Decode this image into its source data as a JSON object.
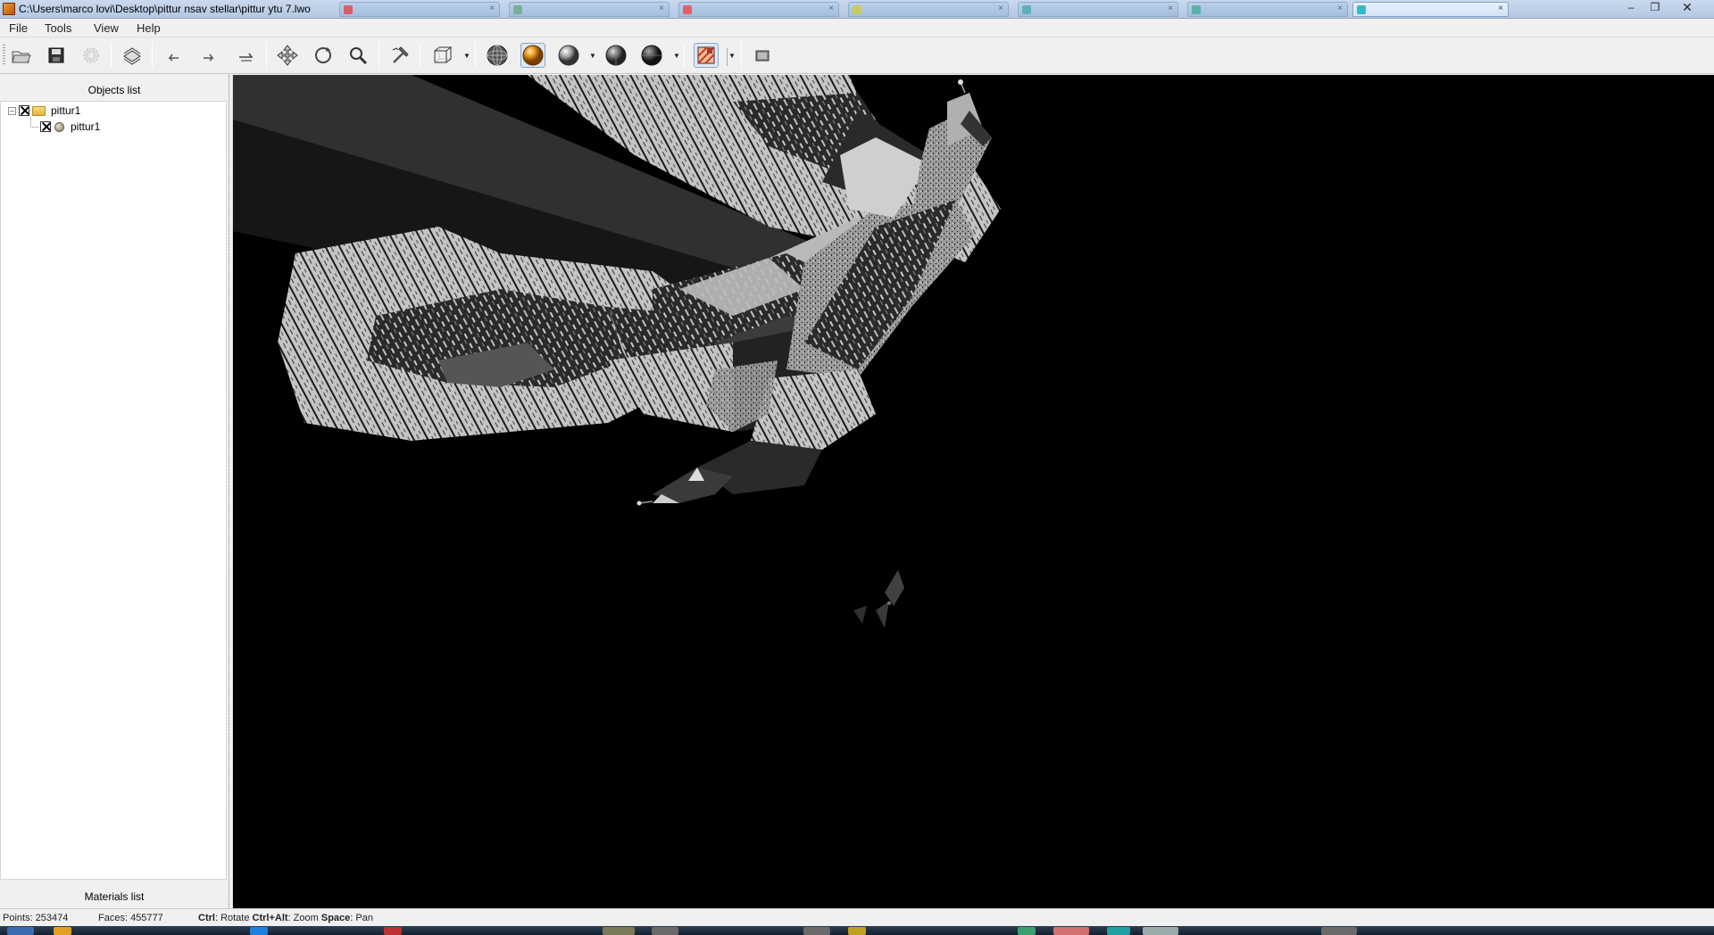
{
  "window": {
    "title": "C:\\Users\\marco lovi\\Desktop\\pittur nsav stellar\\pittur ytu 7.lwo",
    "controls": [
      "minimize",
      "maximize",
      "close"
    ]
  },
  "menu": {
    "file": "File",
    "tools": "Tools",
    "view": "View",
    "help": "Help"
  },
  "toolbar": {
    "buttons": [
      "open-icon",
      "save-icon",
      "render-icon",
      "print-icon",
      "undo-icon",
      "redo-icon",
      "reset-view-icon",
      "move-icon",
      "rotate-icon",
      "zoom-icon",
      "hammer-icon",
      "wireframe-box-icon",
      "wireframe-sphere-icon",
      "shaded-sphere-icon",
      "smooth-sphere-icon",
      "flat-sphere-icon",
      "dark-sphere-icon",
      "texture-icon",
      "screenshot-icon"
    ]
  },
  "objects_panel": {
    "header": "Objects list",
    "tree": [
      {
        "label": "pittur1",
        "type": "folder",
        "checked": true,
        "expanded": true
      },
      {
        "label": "pittur1",
        "type": "mesh",
        "checked": true
      }
    ]
  },
  "materials_panel": {
    "header": "Materials list"
  },
  "status": {
    "points": "Points: 253474",
    "faces": "Faces: 455777",
    "ctrl_key": "Ctrl",
    "ctrl_action": ": Rotate ",
    "ctrlalt_key": "Ctrl+Alt",
    "ctrlalt_action": ": Zoom ",
    "space_key": "Space",
    "space_action": ": Pan"
  },
  "colors": {
    "viewport_bg": "#000000",
    "model_light": "#c8c8c8",
    "model_dark": "#2a2a2a",
    "panel_bg": "#f0f0f0"
  }
}
